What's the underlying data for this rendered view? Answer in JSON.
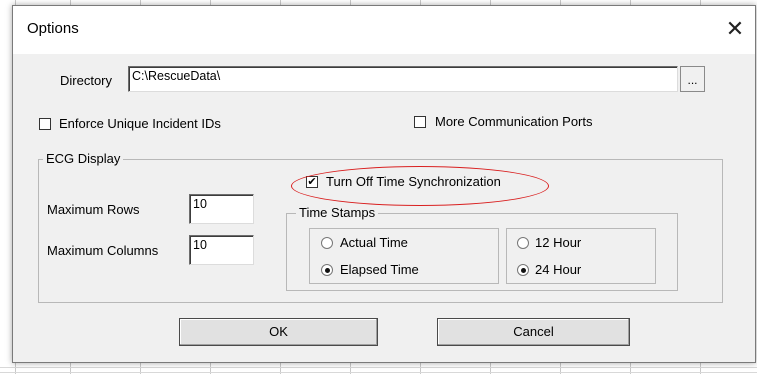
{
  "dialog": {
    "title": "Options",
    "close_glyph": "✕"
  },
  "directory": {
    "label": "Directory",
    "value": "C:\\RescueData\\",
    "browse_label": "..."
  },
  "options": {
    "enforce_unique_label": "Enforce Unique Incident IDs",
    "enforce_unique_checked": false,
    "more_ports_label": "More Communication Ports",
    "more_ports_checked": false
  },
  "ecg_display": {
    "group_label": "ECG Display",
    "max_rows_label": "Maximum Rows",
    "max_rows_value": "10",
    "max_columns_label": "Maximum Columns",
    "max_columns_value": "10",
    "time_sync_label": "Turn Off Time Synchronization",
    "time_sync_checked": true,
    "check_glyph": "✔",
    "time_stamps": {
      "group_label": "Time Stamps",
      "actual_time_label": "Actual Time",
      "elapsed_time_label": "Elapsed Time",
      "selected_mode": "Elapsed Time",
      "hour_12_label": "12 Hour",
      "hour_24_label": "24 Hour",
      "selected_format": "24 Hour"
    }
  },
  "buttons": {
    "ok_label": "OK",
    "cancel_label": "Cancel"
  },
  "colors": {
    "highlight_ellipse": "#d92020",
    "dialog_bg": "#f0f0f0"
  }
}
